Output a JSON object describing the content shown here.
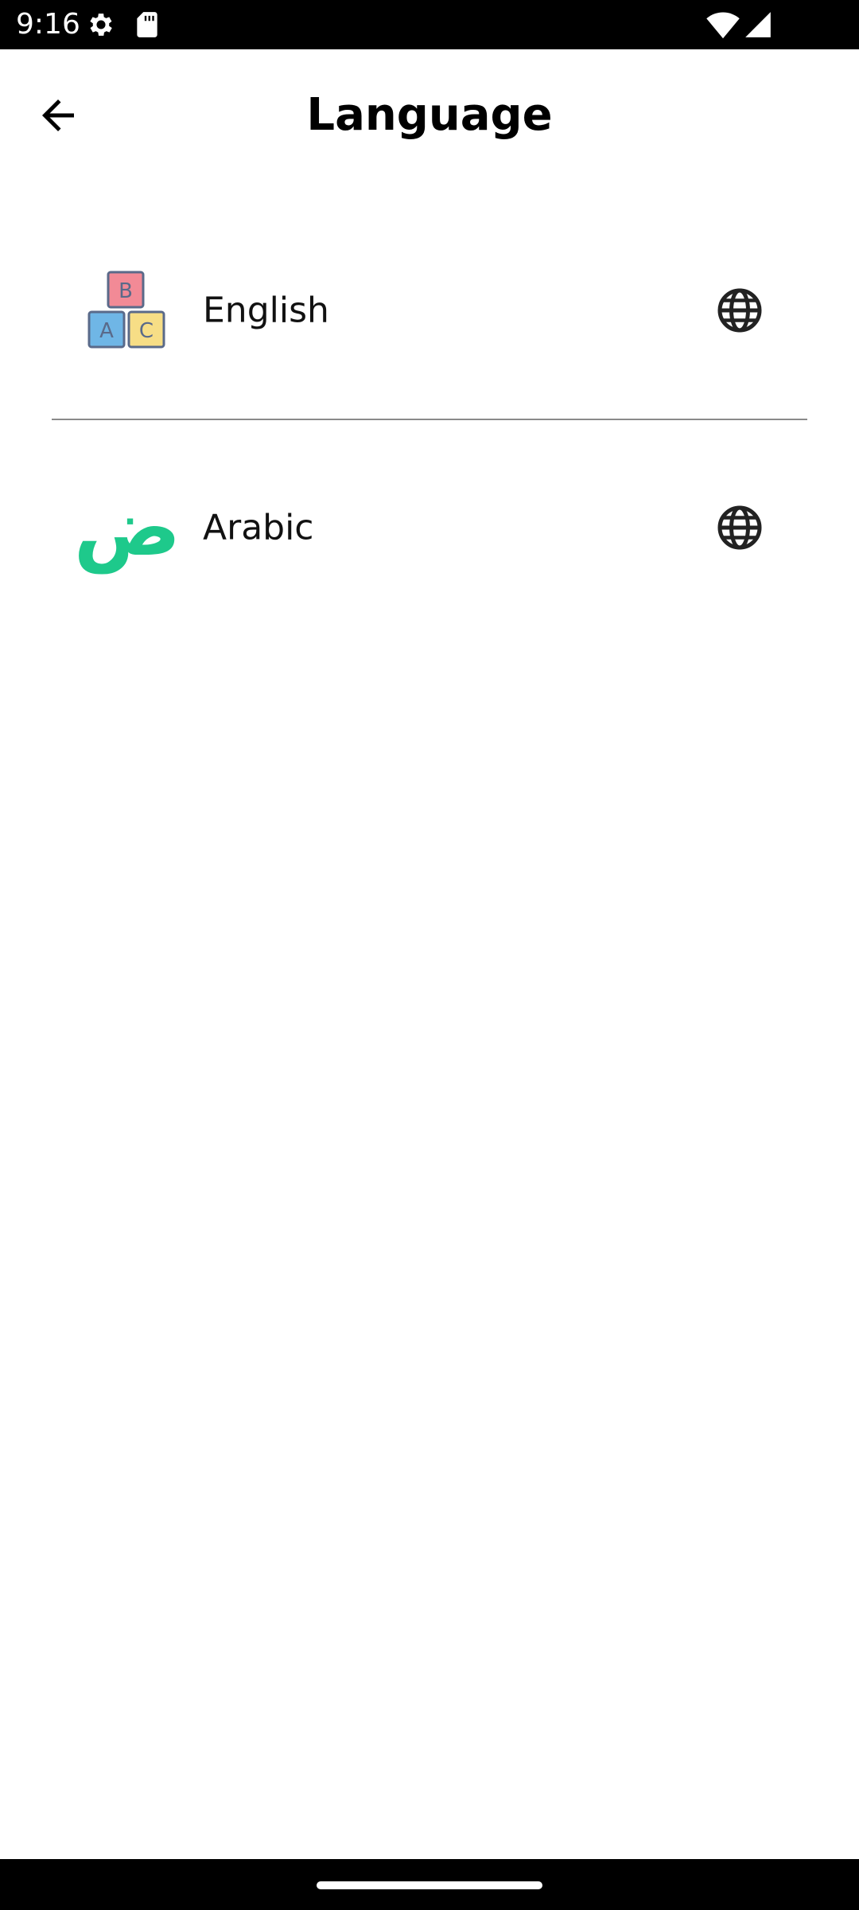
{
  "status_bar": {
    "time": "9:16",
    "icons": [
      "settings-icon",
      "sd-card-icon",
      "wifi-icon",
      "signal-icon"
    ]
  },
  "app_bar": {
    "title": "Language",
    "back_icon": "arrow-back-icon"
  },
  "languages": [
    {
      "label": "English",
      "icon": "abc-blocks-icon",
      "action_icon": "globe-icon",
      "block_letters": [
        "B",
        "A",
        "C"
      ]
    },
    {
      "label": "Arabic",
      "icon": "arabic-letter-icon",
      "action_icon": "globe-icon",
      "glyph": "ض"
    }
  ],
  "colors": {
    "status_bar": "#000000",
    "background": "#ffffff",
    "divider": "#8a8a8a",
    "arabic_green": "#1ec98b",
    "block_pink": "#f28a96",
    "block_blue": "#6fb6e6",
    "block_yellow": "#f7de86"
  }
}
